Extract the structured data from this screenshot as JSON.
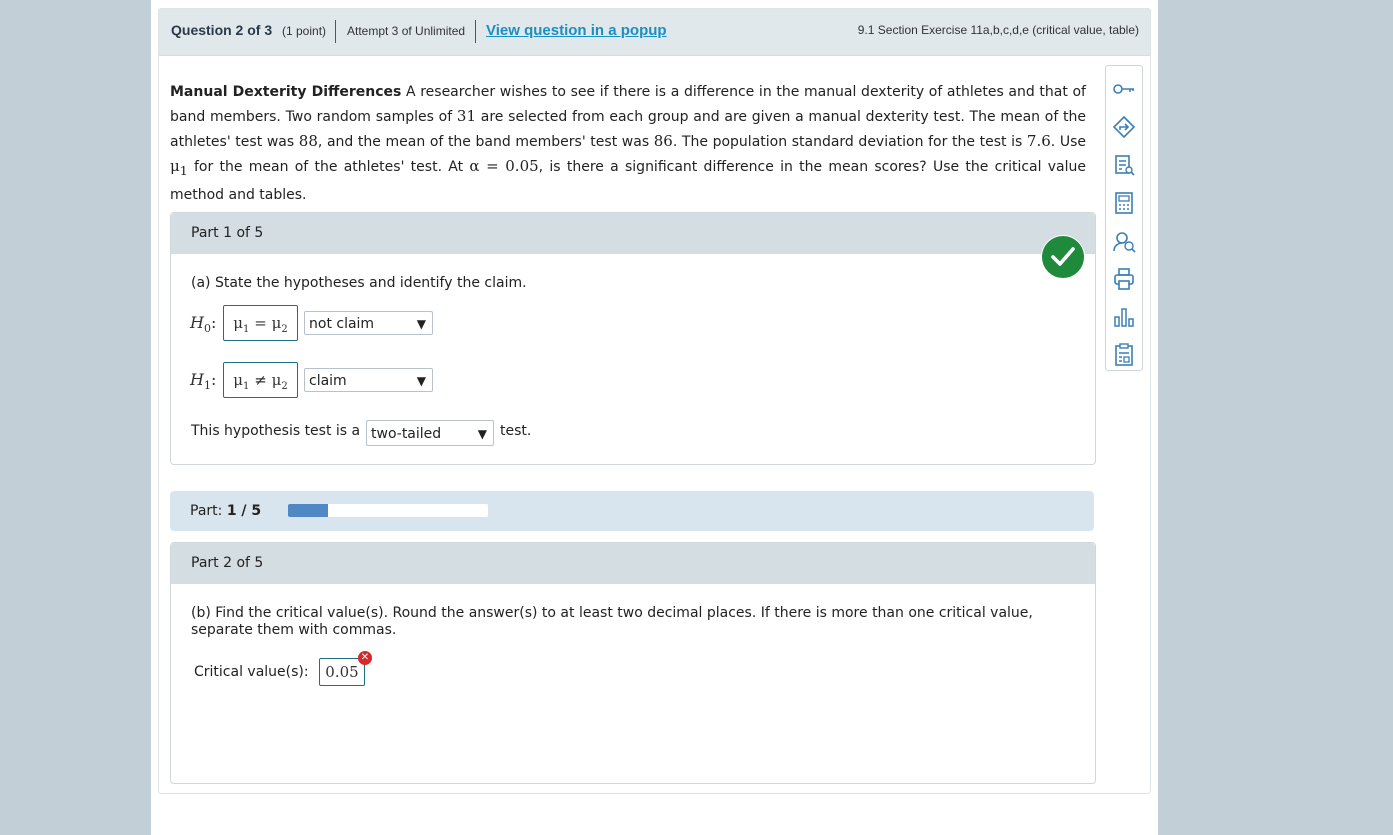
{
  "header": {
    "question": "Question 2 of 3",
    "points": "(1 point)",
    "attempt": "Attempt 3 of Unlimited",
    "popup_link": "View question in a popup",
    "section": "9.1 Section Exercise 11a,b,c,d,e (critical value, table)"
  },
  "problem": {
    "title": "Manual Dexterity Differences",
    "s1": "A researcher wishes to see if there is a difference in the manual dexterity of athletes and that of band members. Two random samples of",
    "n": "31",
    "s2": "are selected from each group and are given a manual dexterity test. The mean of the athletes' test was",
    "mean1": "88",
    "s3": ", and the mean of the band members' test was",
    "mean2": "86",
    "s4": ". The population standard deviation for the test is",
    "sd": "7.6",
    "s5": ". Use",
    "mu1": "μ",
    "mu1_sub": "1",
    "s6": "for the mean of the athletes' test. At",
    "alpha": "α = 0.05",
    "s7": ", is there a significant difference in the mean scores? Use the critical value method and tables."
  },
  "toolbar": {
    "icons": [
      "key-icon",
      "directions-icon",
      "notes-icon",
      "calculator-icon",
      "help-person-icon",
      "print-icon",
      "bar-chart-icon",
      "clipboard-icon"
    ],
    "color": "#3b7fb6"
  },
  "part1": {
    "header": "Part 1 of 5",
    "prompt": "(a) State the hypotheses and identify the claim.",
    "h0_label": "H",
    "h0_sub": "0",
    "colon": ":",
    "h0_expr_a": "μ",
    "h0_expr_a_sub": "1",
    "h0_op": "=",
    "h0_expr_b": "μ",
    "h0_expr_b_sub": "2",
    "h0_select": "not claim",
    "h1_label": "H",
    "h1_sub": "1",
    "h1_expr_a": "μ",
    "h1_expr_a_sub": "1",
    "h1_op": "≠",
    "h1_expr_b": "μ",
    "h1_expr_b_sub": "2",
    "h1_select": "claim",
    "test_pre": "This hypothesis test is a",
    "test_select": "two-tailed",
    "test_post": "test.",
    "status": "correct",
    "arrow": "▼"
  },
  "progress": {
    "label": "Part:",
    "value": "1 / 5",
    "fraction": 0.2
  },
  "part2": {
    "header": "Part 2 of 5",
    "prompt": "(b) Find the critical value(s). Round the answer(s) to at least two decimal places. If there is more than one critical value, separate them with commas.",
    "cv_label": "Critical value(s):",
    "cv_value": "0.05",
    "cv_status": "incorrect",
    "err_symbol": "✕"
  }
}
